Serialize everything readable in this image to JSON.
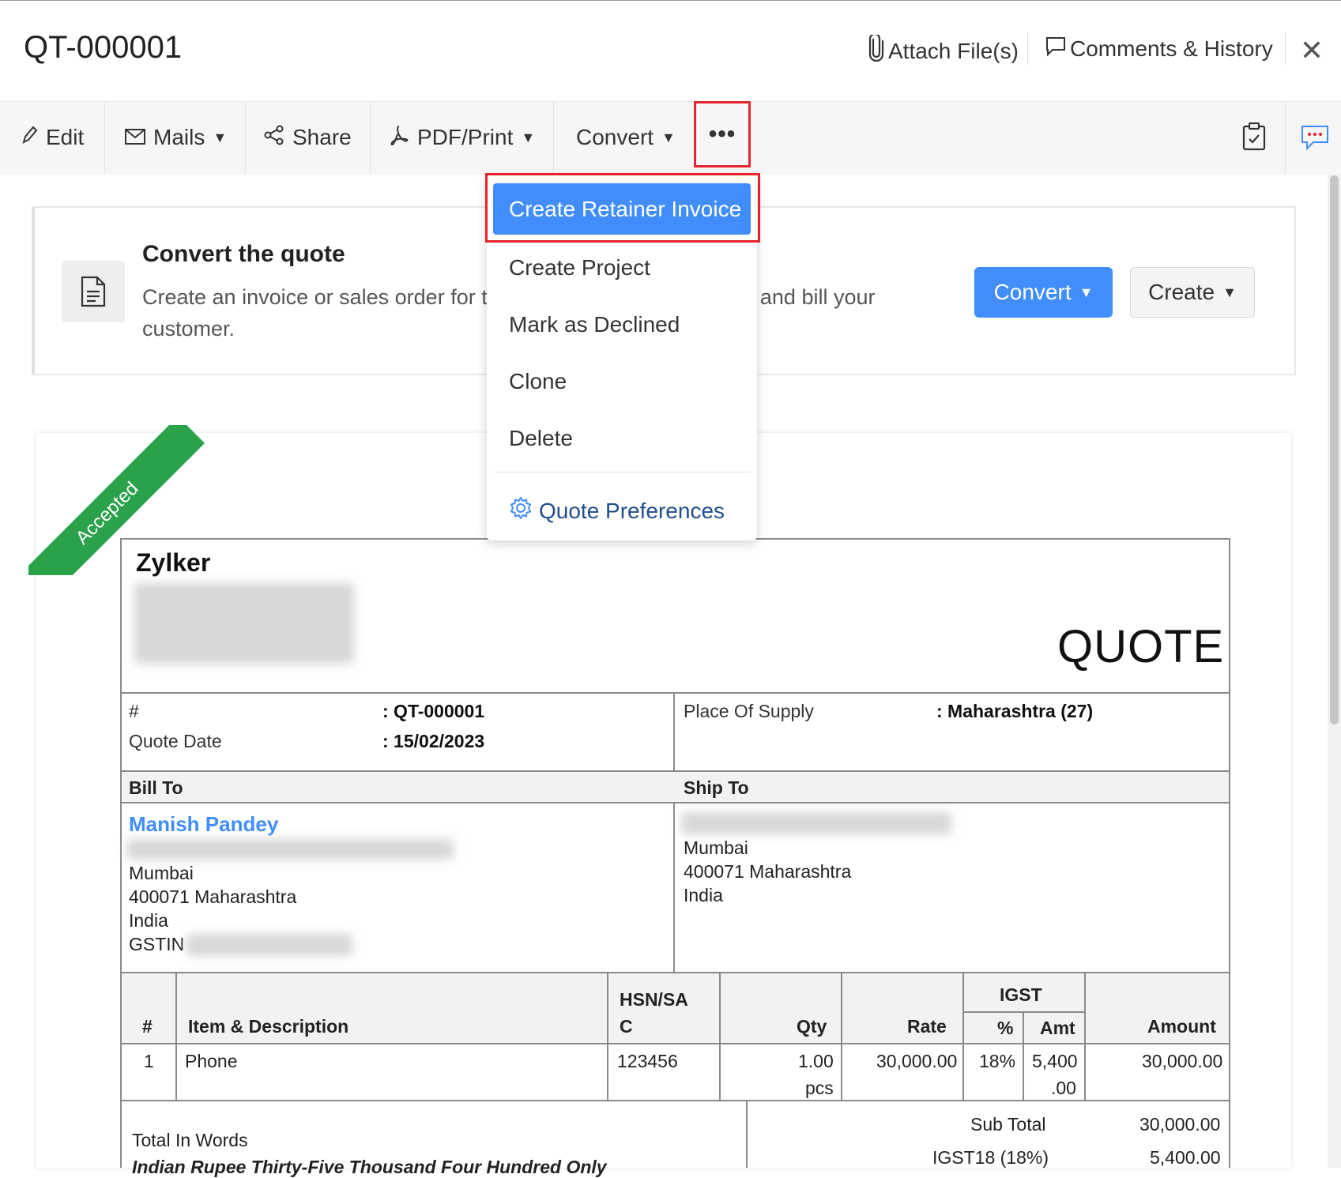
{
  "header": {
    "title": "QT-000001",
    "attach_label": "Attach File(s)",
    "comments_label": "Comments & History"
  },
  "toolbar": {
    "edit": "Edit",
    "mails": "Mails",
    "share": "Share",
    "pdf_print": "PDF/Print",
    "convert": "Convert",
    "more": "•••"
  },
  "banner": {
    "title": "Convert the quote",
    "text": "Create an invoice or sales order for this quote to confirm the sale and bill your customer.",
    "convert_button": "Convert",
    "create_button": "Create"
  },
  "dropdown": {
    "items": [
      "Create Retainer Invoice",
      "Create Project",
      "Mark as Declined",
      "Clone",
      "Delete"
    ],
    "preferences": "Quote Preferences"
  },
  "document": {
    "status_ribbon": "Accepted",
    "org_name": "Zylker",
    "doc_type": "QUOTE",
    "meta": {
      "number_label": "#",
      "number_value": ": QT-000001",
      "date_label": "Quote Date",
      "date_value": ": 15/02/2023",
      "supply_label": "Place Of Supply",
      "supply_value": ": Maharashtra (27)"
    },
    "bill_to": {
      "heading": "Bill To",
      "name": "Manish Pandey",
      "city": "Mumbai",
      "postal_state": "400071 Maharashtra",
      "country": "India",
      "gstin_label": "GSTIN"
    },
    "ship_to": {
      "heading": "Ship To",
      "city": "Mumbai",
      "postal_state": "400071 Maharashtra",
      "country": "India"
    },
    "items_table": {
      "headers": {
        "num": "#",
        "item": "Item & Description",
        "hsn_1": "HSN/SA",
        "hsn_2": "C",
        "qty": "Qty",
        "rate": "Rate",
        "igst": "IGST",
        "igst_pct": "%",
        "igst_amt": "Amt",
        "amount": "Amount"
      },
      "rows": [
        {
          "num": "1",
          "item": "Phone",
          "hsn": "123456",
          "qty": "1.00",
          "unit": "pcs",
          "rate": "30,000.00",
          "igst_pct": "18%",
          "igst_amt_1": "5,400",
          "igst_amt_2": ".00",
          "amount": "30,000.00"
        }
      ]
    },
    "totals": {
      "words_label": "Total In Words",
      "words_value": "Indian Rupee Thirty-Five Thousand Four Hundred Only",
      "subtotal_label": "Sub Total",
      "subtotal_value": "30,000.00",
      "igst_label": "IGST18 (18%)",
      "igst_value": "5,400.00"
    }
  },
  "colors": {
    "accent": "#408dfb",
    "highlight": "#e8232a",
    "ribbon": "#2aa24a"
  }
}
